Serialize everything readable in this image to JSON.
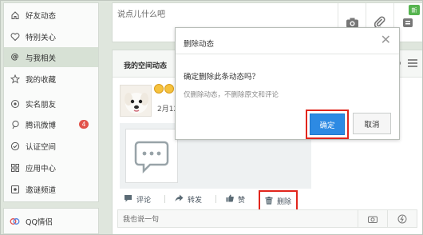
{
  "sidebar": {
    "items": [
      {
        "label": "好友动态",
        "icon": "home-icon"
      },
      {
        "label": "特别关心",
        "icon": "heart-icon"
      },
      {
        "label": "与我相关",
        "icon": "at-icon"
      },
      {
        "label": "我的收藏",
        "icon": "star-icon"
      },
      {
        "label": "实名朋友",
        "icon": "real-name-friends-icon"
      },
      {
        "label": "腾讯微博",
        "icon": "weibo-icon",
        "badge": "4"
      },
      {
        "label": "认证空间",
        "icon": "verified-icon"
      },
      {
        "label": "应用中心",
        "icon": "apps-icon"
      },
      {
        "label": "邀谜频道",
        "icon": "channel-icon"
      }
    ],
    "active_index": 2,
    "qq_lover": "QQ情侣"
  },
  "composer": {
    "placeholder": "说点儿什么吧",
    "new_badge": "新"
  },
  "feed": {
    "title": "我的空间动态",
    "post_time": "2月12",
    "actions": {
      "comment": "评论",
      "forward": "转发",
      "like": "赞",
      "delete": "删除"
    },
    "reply_placeholder": "我也说一句"
  },
  "dialog": {
    "title": "删除动态",
    "question": "确定删除此条动态吗？",
    "note": "仅删除动态，不删除原文和评论",
    "confirm": "确定",
    "cancel": "取消"
  },
  "colors": {
    "accent_blue": "#2d8ae3",
    "highlight_red": "#e1261c",
    "badge_red": "#e2534a",
    "new_badge_green": "#56b44f"
  }
}
